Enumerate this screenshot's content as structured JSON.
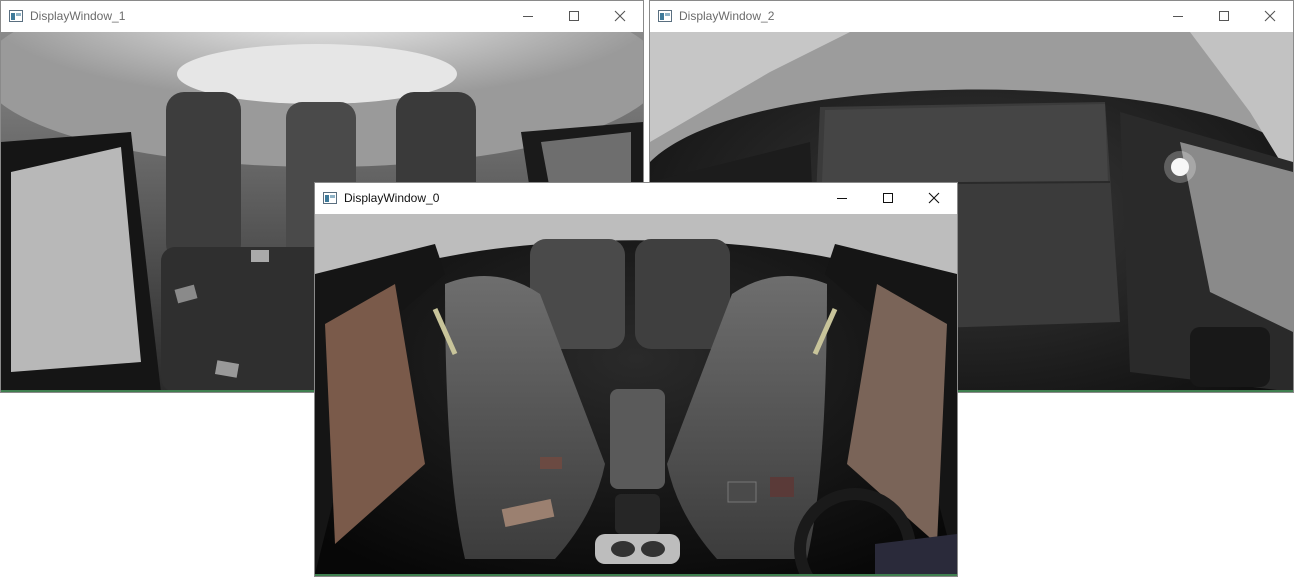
{
  "windows": [
    {
      "id": "w1",
      "title": "DisplayWindow_1"
    },
    {
      "id": "w2",
      "title": "DisplayWindow_2"
    },
    {
      "id": "w0",
      "title": "DisplayWindow_0"
    }
  ],
  "caption_buttons": {
    "minimize": "minimize-icon",
    "maximize": "maximize-icon",
    "close": "close-icon"
  },
  "colors": {
    "titlebar": "#ffffff",
    "inactive_title_text": "#6b6b6b",
    "active_title_text": "#111111",
    "border": "#8a8a8a"
  }
}
